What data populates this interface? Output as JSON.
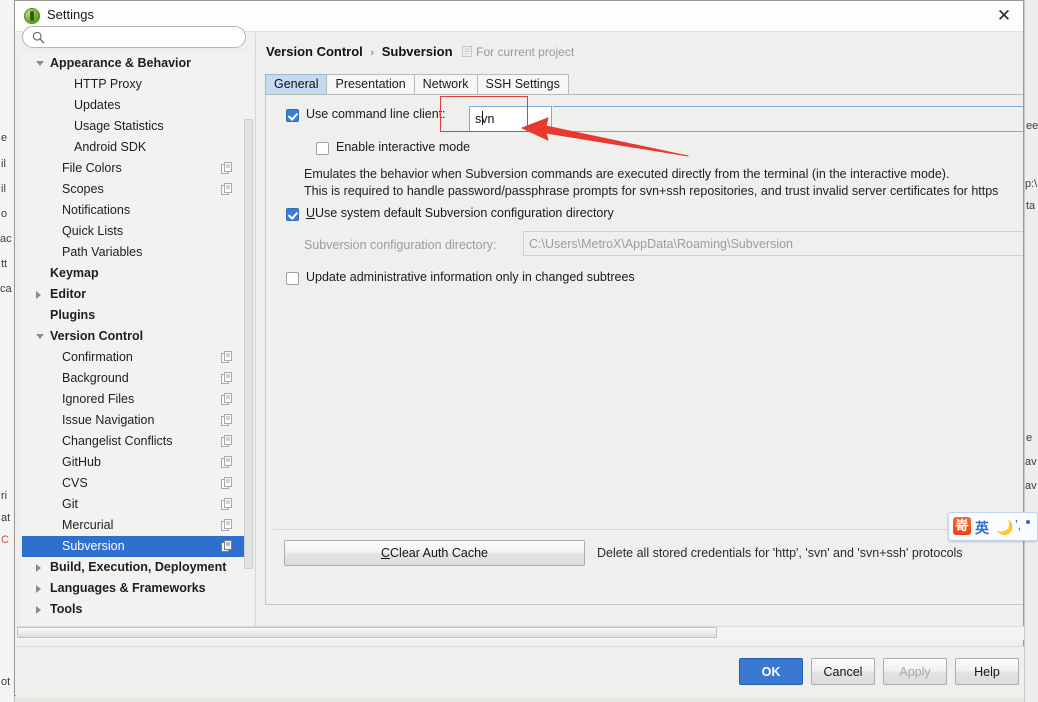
{
  "window": {
    "title": "Settings",
    "app_icon": "intellij-idea-icon",
    "close_label": "✕"
  },
  "search": {
    "placeholder": "",
    "value": "",
    "icon": "search-icon"
  },
  "sidebar": {
    "items": [
      {
        "label": "Appearance & Behavior",
        "indent": 28,
        "bold": true,
        "toggle": "down",
        "config_icon": false,
        "selected": false
      },
      {
        "label": "HTTP Proxy",
        "indent": 52,
        "bold": false,
        "toggle": "none",
        "config_icon": false,
        "selected": false
      },
      {
        "label": "Updates",
        "indent": 52,
        "bold": false,
        "toggle": "none",
        "config_icon": false,
        "selected": false
      },
      {
        "label": "Usage Statistics",
        "indent": 52,
        "bold": false,
        "toggle": "none",
        "config_icon": false,
        "selected": false
      },
      {
        "label": "Android SDK",
        "indent": 52,
        "bold": false,
        "toggle": "none",
        "config_icon": false,
        "selected": false
      },
      {
        "label": "File Colors",
        "indent": 40,
        "bold": false,
        "toggle": "none",
        "config_icon": true,
        "selected": false
      },
      {
        "label": "Scopes",
        "indent": 40,
        "bold": false,
        "toggle": "none",
        "config_icon": true,
        "selected": false
      },
      {
        "label": "Notifications",
        "indent": 40,
        "bold": false,
        "toggle": "none",
        "config_icon": false,
        "selected": false
      },
      {
        "label": "Quick Lists",
        "indent": 40,
        "bold": false,
        "toggle": "none",
        "config_icon": false,
        "selected": false
      },
      {
        "label": "Path Variables",
        "indent": 40,
        "bold": false,
        "toggle": "none",
        "config_icon": false,
        "selected": false
      },
      {
        "label": "Keymap",
        "indent": 28,
        "bold": true,
        "toggle": "none",
        "config_icon": false,
        "selected": false
      },
      {
        "label": "Editor",
        "indent": 28,
        "bold": true,
        "toggle": "right",
        "config_icon": false,
        "selected": false
      },
      {
        "label": "Plugins",
        "indent": 28,
        "bold": true,
        "toggle": "none",
        "config_icon": false,
        "selected": false
      },
      {
        "label": "Version Control",
        "indent": 28,
        "bold": true,
        "toggle": "down",
        "config_icon": false,
        "selected": false
      },
      {
        "label": "Confirmation",
        "indent": 40,
        "bold": false,
        "toggle": "none",
        "config_icon": true,
        "selected": false
      },
      {
        "label": "Background",
        "indent": 40,
        "bold": false,
        "toggle": "none",
        "config_icon": true,
        "selected": false
      },
      {
        "label": "Ignored Files",
        "indent": 40,
        "bold": false,
        "toggle": "none",
        "config_icon": true,
        "selected": false
      },
      {
        "label": "Issue Navigation",
        "indent": 40,
        "bold": false,
        "toggle": "none",
        "config_icon": true,
        "selected": false
      },
      {
        "label": "Changelist Conflicts",
        "indent": 40,
        "bold": false,
        "toggle": "none",
        "config_icon": true,
        "selected": false
      },
      {
        "label": "GitHub",
        "indent": 40,
        "bold": false,
        "toggle": "none",
        "config_icon": true,
        "selected": false
      },
      {
        "label": "CVS",
        "indent": 40,
        "bold": false,
        "toggle": "none",
        "config_icon": true,
        "selected": false
      },
      {
        "label": "Git",
        "indent": 40,
        "bold": false,
        "toggle": "none",
        "config_icon": true,
        "selected": false
      },
      {
        "label": "Mercurial",
        "indent": 40,
        "bold": false,
        "toggle": "none",
        "config_icon": true,
        "selected": false
      },
      {
        "label": "Subversion",
        "indent": 40,
        "bold": false,
        "toggle": "none",
        "config_icon": true,
        "selected": true
      },
      {
        "label": "Build, Execution, Deployment",
        "indent": 28,
        "bold": true,
        "toggle": "right",
        "config_icon": false,
        "selected": false
      },
      {
        "label": "Languages & Frameworks",
        "indent": 28,
        "bold": true,
        "toggle": "right",
        "config_icon": false,
        "selected": false
      },
      {
        "label": "Tools",
        "indent": 28,
        "bold": true,
        "toggle": "right",
        "config_icon": false,
        "selected": false
      }
    ]
  },
  "main": {
    "breadcrumb": {
      "root": "Version Control",
      "separator": "›",
      "leaf": "Subversion",
      "scope_note": "For current project",
      "scope_icon": "project-scope-icon"
    },
    "tabs": [
      {
        "label": "General",
        "active": true
      },
      {
        "label": "Presentation",
        "active": false
      },
      {
        "label": "Network",
        "active": false
      },
      {
        "label": "SSH Settings",
        "active": false
      }
    ],
    "use_command_line_client": {
      "label": "Use command line client:",
      "checked": true,
      "value": "svn"
    },
    "enable_interactive_mode": {
      "label": "Enable interactive mode",
      "checked": false
    },
    "description_line1": "Emulates the behavior when Subversion commands are executed directly from the terminal (in the interactive mode).",
    "description_line2": "This is required to handle password/passphrase prompts for svn+ssh repositories, and trust invalid server certificates for https",
    "use_system_default_dir": {
      "label": "Use system default Subversion configuration directory",
      "checked": true
    },
    "config_dir": {
      "label": "Subversion configuration directory:",
      "value": "C:\\Users\\MetroX\\AppData\\Roaming\\Subversion",
      "enabled": false
    },
    "update_admin_info": {
      "label": "Update administrative information only in changed subtrees",
      "checked": false
    },
    "clear_auth_cache": {
      "label": "Clear Auth Cache",
      "hint": "Delete all stored credentials for 'http', 'svn' and 'svn+ssh' protocols"
    }
  },
  "footer": {
    "ok": "OK",
    "cancel": "Cancel",
    "apply": "Apply",
    "help": "Help",
    "apply_disabled": true
  },
  "annotation": {
    "color": "#e23b3b",
    "highlight_target": "use-command-line-client-input",
    "shape": "arrow-pointing-left"
  },
  "ime": {
    "logo": "嵜",
    "mode": "英",
    "moon_icon": "moon-icon",
    "punctuation_icon": "punctuation-icon",
    "extra_icon": "dot-icon"
  },
  "background_window": {
    "left_fragments": [
      "e",
      "il",
      "il",
      "o",
      "ac",
      "tt",
      "ca",
      "ri",
      "at",
      "C",
      "ot"
    ],
    "right_fragments": [
      "ee",
      "p:\\L",
      "ta",
      "e",
      "av",
      "av"
    ]
  },
  "colors": {
    "accent": "#2f6fce",
    "tab_active": "#c5d9f1",
    "primary_button": "#3a79d2",
    "annotation_red": "#e23b3b",
    "dialog_bg": "#efefed"
  }
}
